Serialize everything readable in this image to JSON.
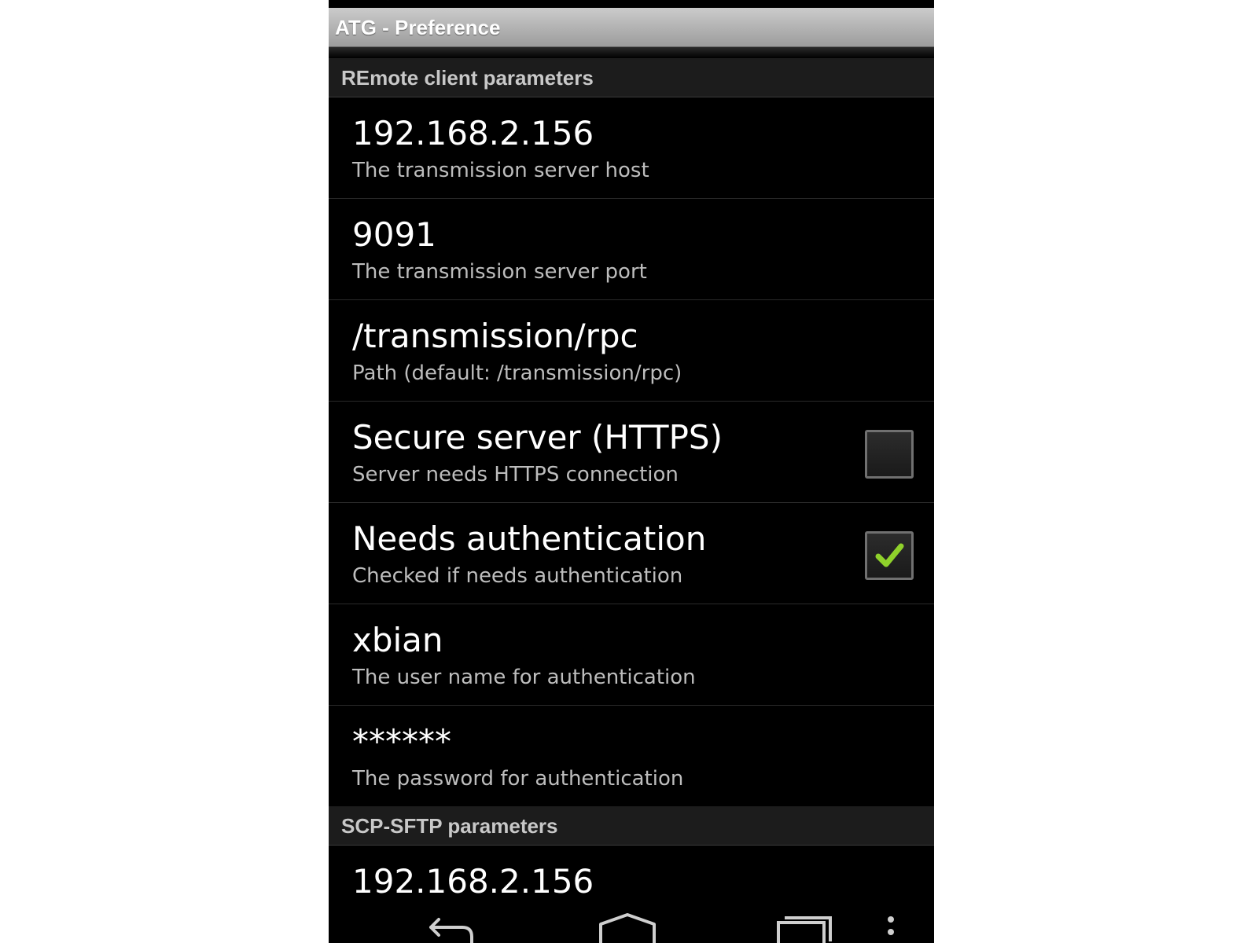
{
  "app": {
    "title": "ATG - Preference"
  },
  "sections": [
    {
      "header": "REmote client parameters",
      "prefs": [
        {
          "title": "192.168.2.156",
          "summary": "The transmission server host"
        },
        {
          "title": "9091",
          "summary": "The transmission server port"
        },
        {
          "title": "/transmission/rpc",
          "summary": "Path (default: /transmission/rpc)"
        },
        {
          "title": "Secure server (HTTPS)",
          "summary": "Server needs HTTPS connection",
          "checked": false
        },
        {
          "title": "Needs authentication",
          "summary": "Checked if needs authentication",
          "checked": true
        },
        {
          "title": "xbian",
          "summary": "The user name for authentication"
        },
        {
          "title": "******",
          "summary": "The password for authentication"
        }
      ]
    },
    {
      "header": "SCP-SFTP parameters",
      "prefs": [
        {
          "title": "192.168.2.156"
        }
      ]
    }
  ],
  "colors": {
    "check_accent": "#8fd12b",
    "title_bar": "#b4b4b4",
    "background": "#000000"
  },
  "nav": {
    "icons": [
      "back-icon",
      "home-icon",
      "recent-apps-icon",
      "menu-overflow-icon"
    ]
  }
}
